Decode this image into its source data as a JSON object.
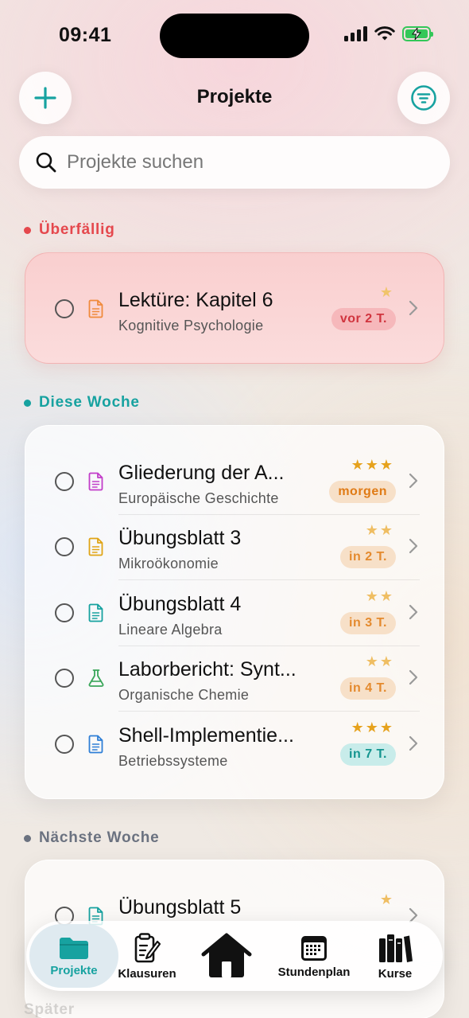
{
  "status_bar": {
    "time": "09:41"
  },
  "header": {
    "title": "Projekte"
  },
  "search": {
    "placeholder": "Projekte suchen"
  },
  "colors": {
    "accent": "#17a2a0",
    "overdue": "#e5484d",
    "star": "#e6a21d"
  },
  "sections": {
    "overdue": {
      "label": "Überfällig",
      "items": [
        {
          "title": "Lektüre: Kapitel 6",
          "subtitle": "Kognitive Psychologie",
          "stars": "★",
          "badge": "vor 2 T.",
          "icon": "document-icon"
        }
      ]
    },
    "this_week": {
      "label": "Diese Woche",
      "items": [
        {
          "title": "Gliederung der A...",
          "subtitle": "Europäische Geschichte",
          "stars": "★★★",
          "badge": "morgen",
          "icon": "document-icon"
        },
        {
          "title": "Übungsblatt 3",
          "subtitle": "Mikroökonomie",
          "stars": "★★",
          "badge": "in 2 T.",
          "icon": "document-icon"
        },
        {
          "title": "Übungsblatt 4",
          "subtitle": "Lineare Algebra",
          "stars": "★★",
          "badge": "in 3 T.",
          "icon": "document-icon"
        },
        {
          "title": "Laborbericht: Synt...",
          "subtitle": "Organische Chemie",
          "stars": "★★",
          "badge": "in 4 T.",
          "icon": "flask-icon"
        },
        {
          "title": "Shell-Implementie...",
          "subtitle": "Betriebssysteme",
          "stars": "★★★",
          "badge": "in 7 T.",
          "icon": "document-icon"
        }
      ]
    },
    "next_week": {
      "label": "Nächste Woche",
      "items": [
        {
          "title": "Übungsblatt 5",
          "stars": "★",
          "icon": "document-icon"
        }
      ]
    },
    "later": {
      "label": "Später"
    }
  },
  "tabbar": {
    "tabs": [
      {
        "label": "Projekte",
        "icon": "folder-icon",
        "active": true
      },
      {
        "label": "Klausuren",
        "icon": "exam-icon"
      },
      {
        "label": "",
        "icon": "home-icon"
      },
      {
        "label": "Stundenplan",
        "icon": "calendar-icon"
      },
      {
        "label": "Kurse",
        "icon": "books-icon"
      }
    ]
  }
}
